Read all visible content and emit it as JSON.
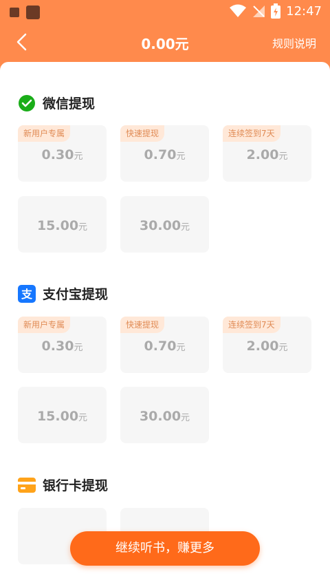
{
  "status_bar": {
    "time": "12:47"
  },
  "header": {
    "title": "0.00元",
    "rules_label": "规则说明"
  },
  "wechat": {
    "title": "微信提现",
    "tiles": [
      {
        "tag": "新用户专属",
        "amount": "0.30",
        "unit": "元"
      },
      {
        "tag": "快速提现",
        "amount": "0.70",
        "unit": "元"
      },
      {
        "tag": "连续签到7天",
        "amount": "2.00",
        "unit": "元"
      },
      {
        "tag": "",
        "amount": "15.00",
        "unit": "元"
      },
      {
        "tag": "",
        "amount": "30.00",
        "unit": "元"
      }
    ]
  },
  "alipay": {
    "title": "支付宝提现",
    "icon_char": "支",
    "tiles": [
      {
        "tag": "新用户专属",
        "amount": "0.30",
        "unit": "元"
      },
      {
        "tag": "快速提现",
        "amount": "0.70",
        "unit": "元"
      },
      {
        "tag": "连续签到7天",
        "amount": "2.00",
        "unit": "元"
      },
      {
        "tag": "",
        "amount": "15.00",
        "unit": "元"
      },
      {
        "tag": "",
        "amount": "30.00",
        "unit": "元"
      }
    ]
  },
  "bank": {
    "title": "银行卡提现"
  },
  "bottom_button": {
    "label": "继续听书，赚更多"
  },
  "colors": {
    "brand_orange": "#ff8a4c",
    "button_orange": "#ff6a1a",
    "tag_bg": "#ffe8d8",
    "wechat_green": "#1aad19",
    "alipay_blue": "#1677ff",
    "bank_orange": "#ffa31a"
  }
}
